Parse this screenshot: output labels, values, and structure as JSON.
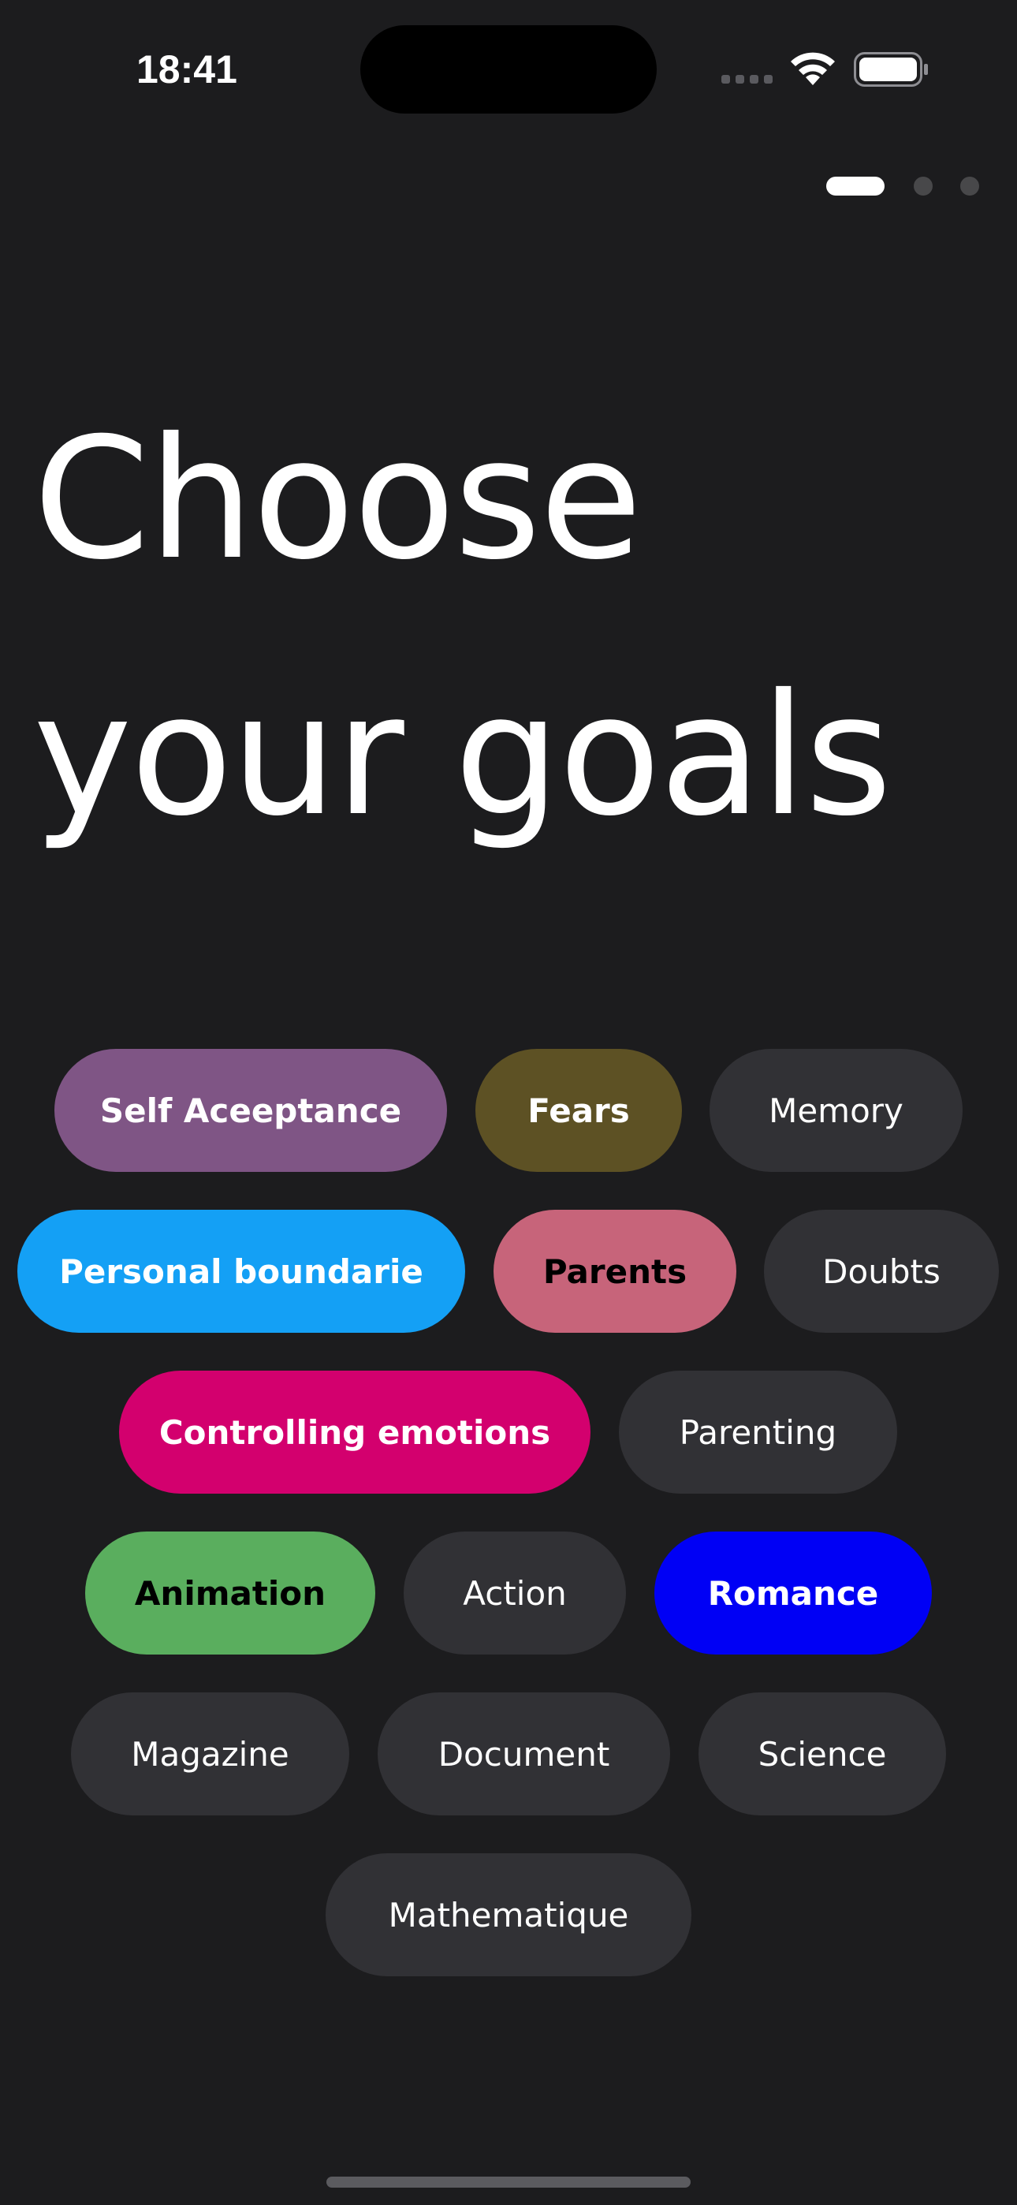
{
  "status_bar": {
    "time": "18:41",
    "icons": [
      "cellular-signal-icon",
      "wifi-icon",
      "battery-icon"
    ]
  },
  "pager": {
    "total": 3,
    "current": 1
  },
  "title": {
    "line1": "Choose",
    "line2": "your goals"
  },
  "colors": {
    "background": "#1c1c1e",
    "chip_default": "#313135",
    "self_acceptance": "#7f5585",
    "fears": "#5d5124",
    "personal_boundaries": "#14a0f5",
    "parents": "#c7647a",
    "controlling_emotions": "#d3006e",
    "animation": "#5aae5e",
    "romance": "#0000f5"
  },
  "goals": [
    {
      "id": "self-acceptance",
      "label": "Self Aceeptance",
      "selected": true,
      "color": "#7f5585",
      "text_color": "#ffffff"
    },
    {
      "id": "fears",
      "label": "Fears",
      "selected": true,
      "color": "#5d5124",
      "text_color": "#ffffff"
    },
    {
      "id": "memory",
      "label": "Memory",
      "selected": false
    },
    {
      "id": "personal-boundaries",
      "label": "Personal boundarie",
      "selected": true,
      "color": "#14a0f5",
      "text_color": "#ffffff"
    },
    {
      "id": "parents",
      "label": "Parents",
      "selected": true,
      "color": "#c7647a",
      "text_color": "#000000"
    },
    {
      "id": "doubts",
      "label": "Doubts",
      "selected": false
    },
    {
      "id": "controlling-emotions",
      "label": "Controlling emotions",
      "selected": true,
      "color": "#d3006e",
      "text_color": "#ffffff"
    },
    {
      "id": "parenting",
      "label": "Parenting",
      "selected": false
    },
    {
      "id": "animation",
      "label": "Animation",
      "selected": true,
      "color": "#5aae5e",
      "text_color": "#000000"
    },
    {
      "id": "action",
      "label": "Action",
      "selected": false
    },
    {
      "id": "romance",
      "label": "Romance",
      "selected": true,
      "color": "#0000f5",
      "text_color": "#ffffff"
    },
    {
      "id": "magazine",
      "label": "Magazine",
      "selected": false
    },
    {
      "id": "document",
      "label": "Document",
      "selected": false
    },
    {
      "id": "science",
      "label": "Science",
      "selected": false
    },
    {
      "id": "mathematique",
      "label": "Mathematique",
      "selected": false
    }
  ]
}
